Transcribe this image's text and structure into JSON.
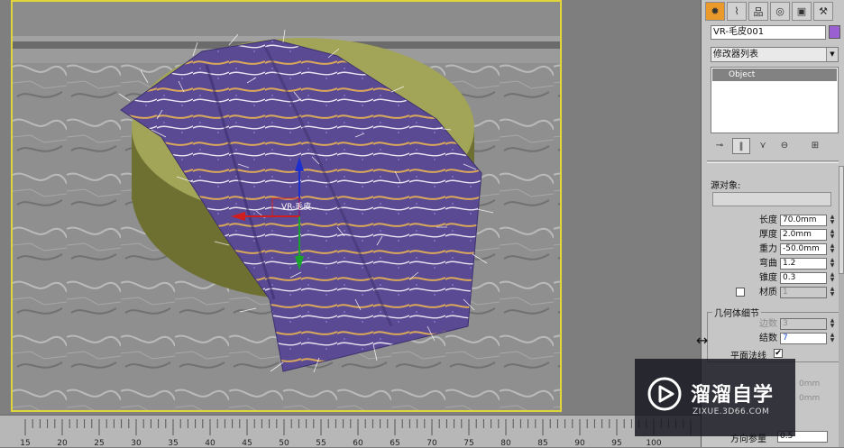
{
  "viewport": {
    "gizmo_label": "VR-毛皮..."
  },
  "timeline": {
    "ticks": [
      "15",
      "20",
      "25",
      "30",
      "35",
      "40",
      "45",
      "50",
      "55",
      "60",
      "65",
      "70",
      "75",
      "80",
      "85",
      "90",
      "95",
      "100"
    ]
  },
  "panel": {
    "tabs": [
      {
        "icon": "create-icon",
        "glyph": "✹"
      },
      {
        "icon": "modify-icon",
        "glyph": "⌇"
      },
      {
        "icon": "hierarchy-icon",
        "glyph": "品"
      },
      {
        "icon": "motion-icon",
        "glyph": "◎"
      },
      {
        "icon": "display-icon",
        "glyph": "▣"
      },
      {
        "icon": "utilities-icon",
        "glyph": "⚒"
      }
    ],
    "object_name": "VR-毛皮001",
    "object_color": "#9a5fd0",
    "modifier_list": "修改器列表",
    "stack_item": "Object",
    "source_object_label": "源对象:",
    "params": {
      "length_label": "长度",
      "length_value": "70.0mm",
      "thickness_label": "厚度",
      "thickness_value": "2.0mm",
      "gravity_label": "重力",
      "gravity_value": "-50.0mm",
      "bend_label": "弯曲",
      "bend_value": "1.2",
      "taper_label": "锥度",
      "taper_value": "0.3",
      "material_label": "材质",
      "material_value": "1"
    },
    "geometry_detail_label": "几何体细节",
    "sides_label": "边数",
    "sides_value": "3",
    "knots_label": "结数",
    "knots_value": "7",
    "flat_normals_label": "平面法线",
    "flat_normals_checked": "✔",
    "partial_label_1": "0mm",
    "partial_label_2": "0mm",
    "bottom_label": "方向参量",
    "bottom_value": "0.5"
  },
  "watermark": {
    "title": "溜溜自学",
    "sub": "ZIXUE.3D66.COM"
  }
}
